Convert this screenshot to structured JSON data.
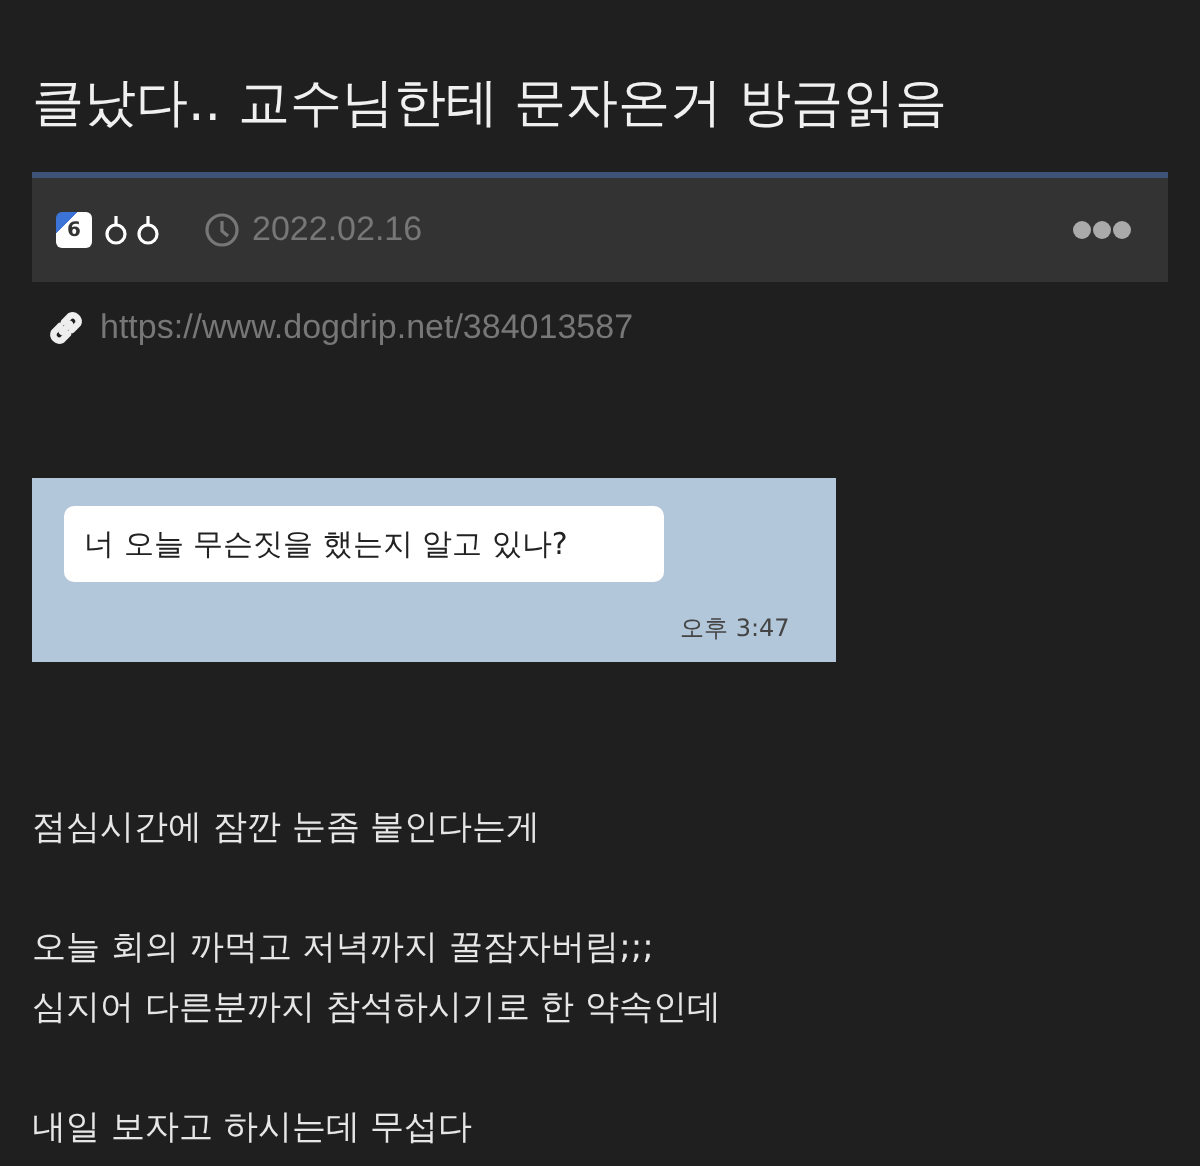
{
  "title": "클났다.. 교수님한테 문자온거 방금읽음",
  "meta": {
    "level_badge": "6",
    "date": "2022.02.16"
  },
  "link": "https://www.dogdrip.net/384013587",
  "chat": {
    "message": "너 오늘 무슨짓을 했는지 알고 있나?",
    "time": "오후 3:47"
  },
  "paragraphs": [
    [
      "점심시간에 잠깐 눈좀 붙인다는게"
    ],
    [
      "오늘 회의 까먹고 저녁까지 꿀잠자버림;;;",
      "심지어 다른분까지 참석하시기로 한 약속인데"
    ],
    [
      "내일 보자고 하시는데 무섭다"
    ]
  ]
}
